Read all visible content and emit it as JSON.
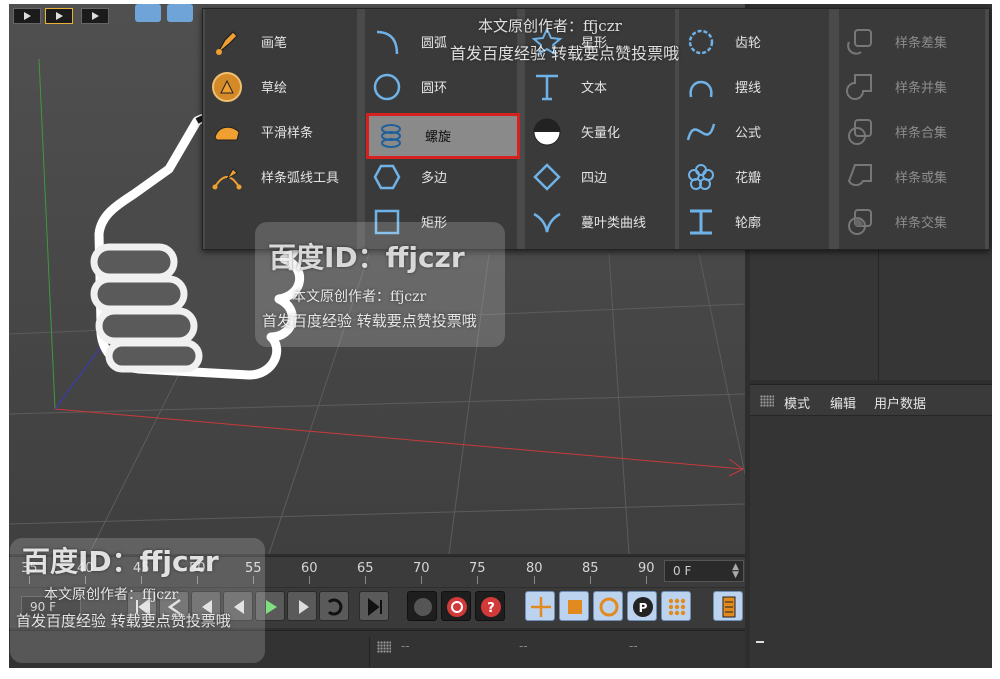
{
  "spline_menu": {
    "col1": [
      {
        "label": "画笔",
        "icon": "pen-icon"
      },
      {
        "label": "草绘",
        "icon": "sketch-icon"
      },
      {
        "label": "平滑样条",
        "icon": "smooth-spline-icon"
      },
      {
        "label": "样条弧线工具",
        "icon": "spline-arc-tool-icon"
      }
    ],
    "col2": [
      {
        "label": "圆弧",
        "icon": "arc-icon"
      },
      {
        "label": "圆环",
        "icon": "circle-icon"
      },
      {
        "label": "螺旋",
        "icon": "helix-icon"
      },
      {
        "label": "多边",
        "icon": "polygon-icon"
      },
      {
        "label": "矩形",
        "icon": "rectangle-icon"
      }
    ],
    "col3": [
      {
        "label": "星形",
        "icon": "star-icon"
      },
      {
        "label": "文本",
        "icon": "text-icon"
      },
      {
        "label": "矢量化",
        "icon": "vectorizer-icon"
      },
      {
        "label": "四边",
        "icon": "4-side-icon"
      },
      {
        "label": "蔓叶类曲线",
        "icon": "cissoid-icon"
      }
    ],
    "col4": [
      {
        "label": "齿轮",
        "icon": "cog-wheel-icon"
      },
      {
        "label": "摆线",
        "icon": "cycloid-icon"
      },
      {
        "label": "公式",
        "icon": "formula-icon"
      },
      {
        "label": "花瓣",
        "icon": "flower-icon"
      },
      {
        "label": "轮廓",
        "icon": "profile-icon"
      }
    ],
    "col5": [
      {
        "label": "样条差集",
        "icon": "spline-subtract-icon"
      },
      {
        "label": "样条并集",
        "icon": "spline-union-icon"
      },
      {
        "label": "样条合集",
        "icon": "spline-and-icon"
      },
      {
        "label": "样条或集",
        "icon": "spline-or-icon"
      },
      {
        "label": "样条交集",
        "icon": "spline-intersect-icon"
      }
    ],
    "highlighted": "螺旋"
  },
  "attributes": {
    "tabs": [
      "模式",
      "编辑",
      "用户数据"
    ]
  },
  "timeline": {
    "ticks": [
      "35",
      "40",
      "45",
      "50",
      "55",
      "60",
      "65",
      "70",
      "75",
      "80",
      "85",
      "90"
    ],
    "current_frame": "0 F",
    "end_frame": "90 F"
  },
  "bottom_bar": {
    "dashes": [
      "--",
      "--",
      "--"
    ]
  },
  "watermark": {
    "id": "百度ID：ffjczr",
    "line1": "本文原创作者：ffjczr",
    "line2": "首发百度经验 转载要点赞投票哦"
  },
  "colors": {
    "highlight_border": "#d5221e",
    "icon_blue": "#6fb2e8",
    "axis_red": "#c83a3a",
    "axis_green": "#3d9a3d",
    "axis_blue": "#3a3ac8"
  }
}
